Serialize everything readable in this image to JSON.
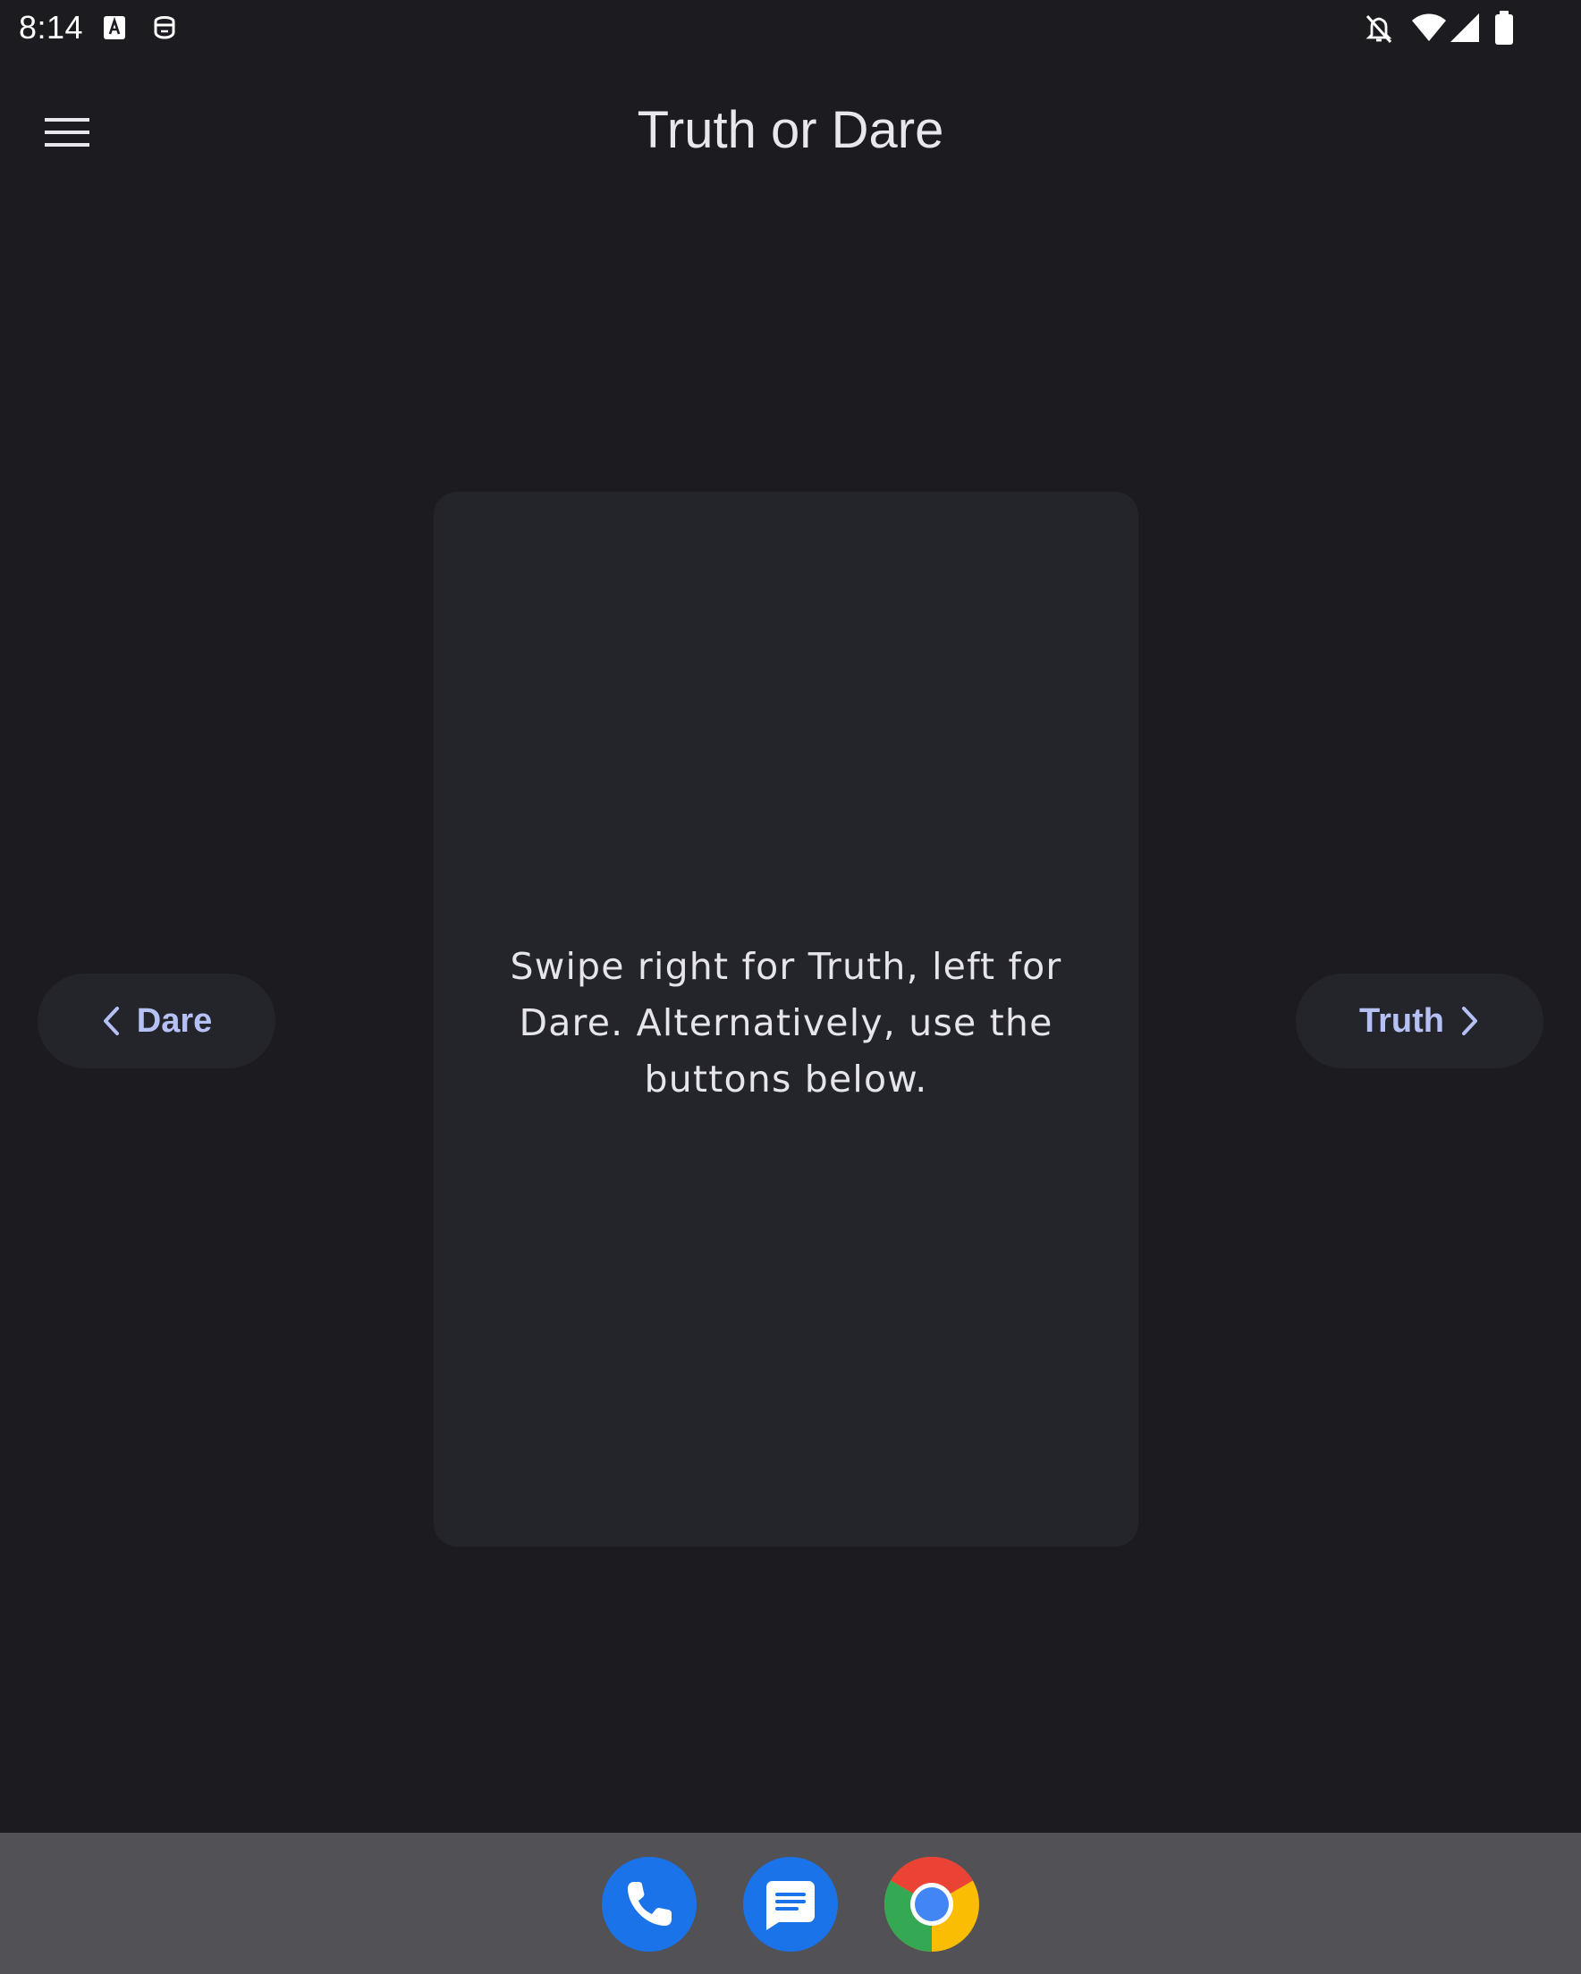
{
  "status_bar": {
    "time": "8:14",
    "left_icons": [
      "keyboard-a-icon",
      "face-retouch-icon"
    ],
    "right_icons": [
      "notifications-off-icon",
      "wifi-icon",
      "cell-signal-icon",
      "battery-icon"
    ]
  },
  "app_bar": {
    "title": "Truth or Dare",
    "menu_icon": "hamburger-menu-icon"
  },
  "card": {
    "instruction": "Swipe right for Truth, left for Dare. Alternatively, use the buttons below."
  },
  "buttons": {
    "dare_label": "Dare",
    "truth_label": "Truth"
  },
  "dock": {
    "apps": [
      "phone-app-icon",
      "messages-app-icon",
      "chrome-app-icon"
    ]
  },
  "colors": {
    "background": "#1b1b20",
    "card": "#23252b",
    "accent": "#b5c0f5",
    "dock": "#515156"
  }
}
